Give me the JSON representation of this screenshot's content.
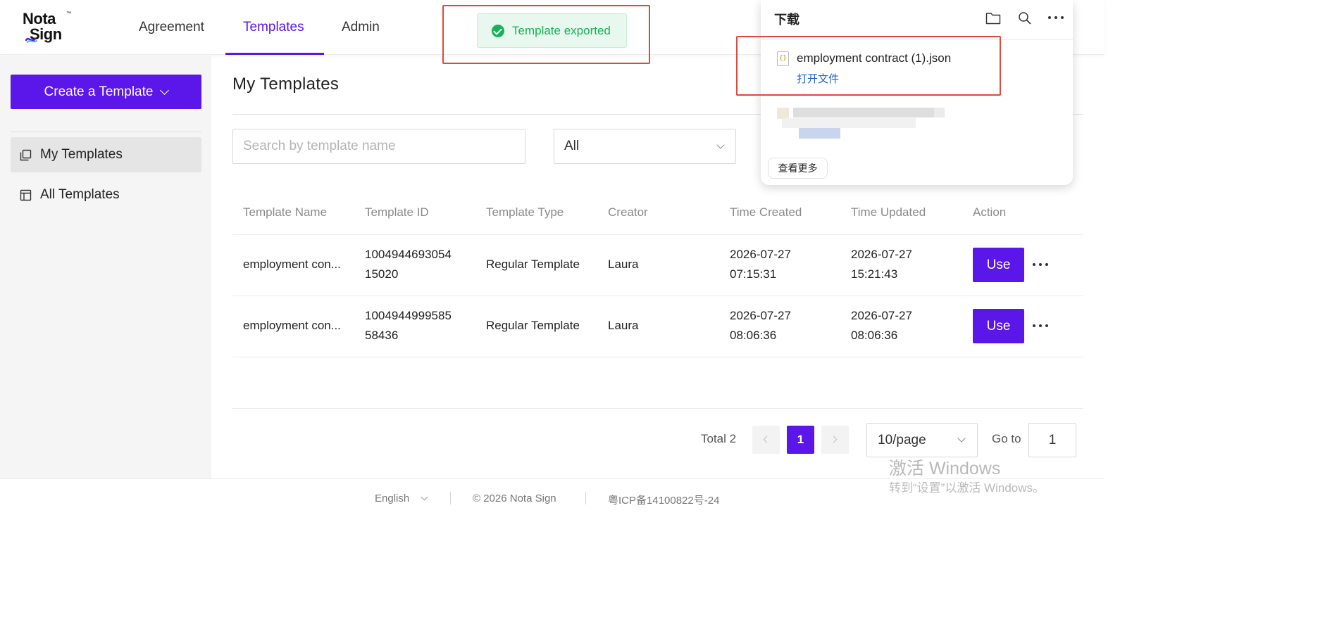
{
  "logo": {
    "line1": "Nota",
    "line2": "Sign",
    "tm": "™"
  },
  "nav": {
    "items": [
      "Agreement",
      "Templates",
      "Admin"
    ],
    "active": "Templates"
  },
  "toast": {
    "message": "Template exported"
  },
  "sidebar": {
    "create_label": "Create a Template",
    "items": [
      {
        "label": "My Templates",
        "icon": "copy-icon",
        "active": true
      },
      {
        "label": "All Templates",
        "icon": "layout-icon",
        "active": false
      }
    ]
  },
  "main": {
    "title": "My Templates",
    "search": {
      "placeholder": "Search by template name",
      "value": ""
    },
    "filter": {
      "selected": "All"
    }
  },
  "table": {
    "columns": [
      "Template Name",
      "Template ID",
      "Template Type",
      "Creator",
      "Time Created",
      "Time Updated",
      "Action"
    ],
    "rows": [
      {
        "name": "employment con...",
        "id_line1": "1004944693054",
        "id_line2": "15020",
        "type": "Regular Template",
        "creator": "Laura",
        "created_date": "2026-07-27",
        "created_time": "07:15:31",
        "updated_date": "2026-07-27",
        "updated_time": "15:21:43",
        "action": "Use"
      },
      {
        "name": "employment con...",
        "id_line1": "1004944999585",
        "id_line2": "58436",
        "type": "Regular Template",
        "creator": "Laura",
        "created_date": "2026-07-27",
        "created_time": "08:06:36",
        "updated_date": "2026-07-27",
        "updated_time": "08:06:36",
        "action": "Use"
      }
    ]
  },
  "pagination": {
    "total": "Total 2",
    "current": "1",
    "page_size": "10/page",
    "goto_label": "Go to",
    "goto_value": "1"
  },
  "footer": {
    "language": "English",
    "copyright": "© 2026 Nota Sign",
    "icp": "粤ICP备14100822号-24"
  },
  "downloads": {
    "title": "下载",
    "file_name": "employment contract (1).json",
    "file_icon_text": "{}",
    "open_label": "打开文件",
    "more_label": "查看更多"
  },
  "watermark": {
    "line1": "激活 Windows",
    "line2": "转到“设置”以激活 Windows。"
  },
  "colors": {
    "brand": "#5b16ea",
    "success": "#16b257",
    "highlight": "#e2473c",
    "link": "#1a5fd1"
  }
}
